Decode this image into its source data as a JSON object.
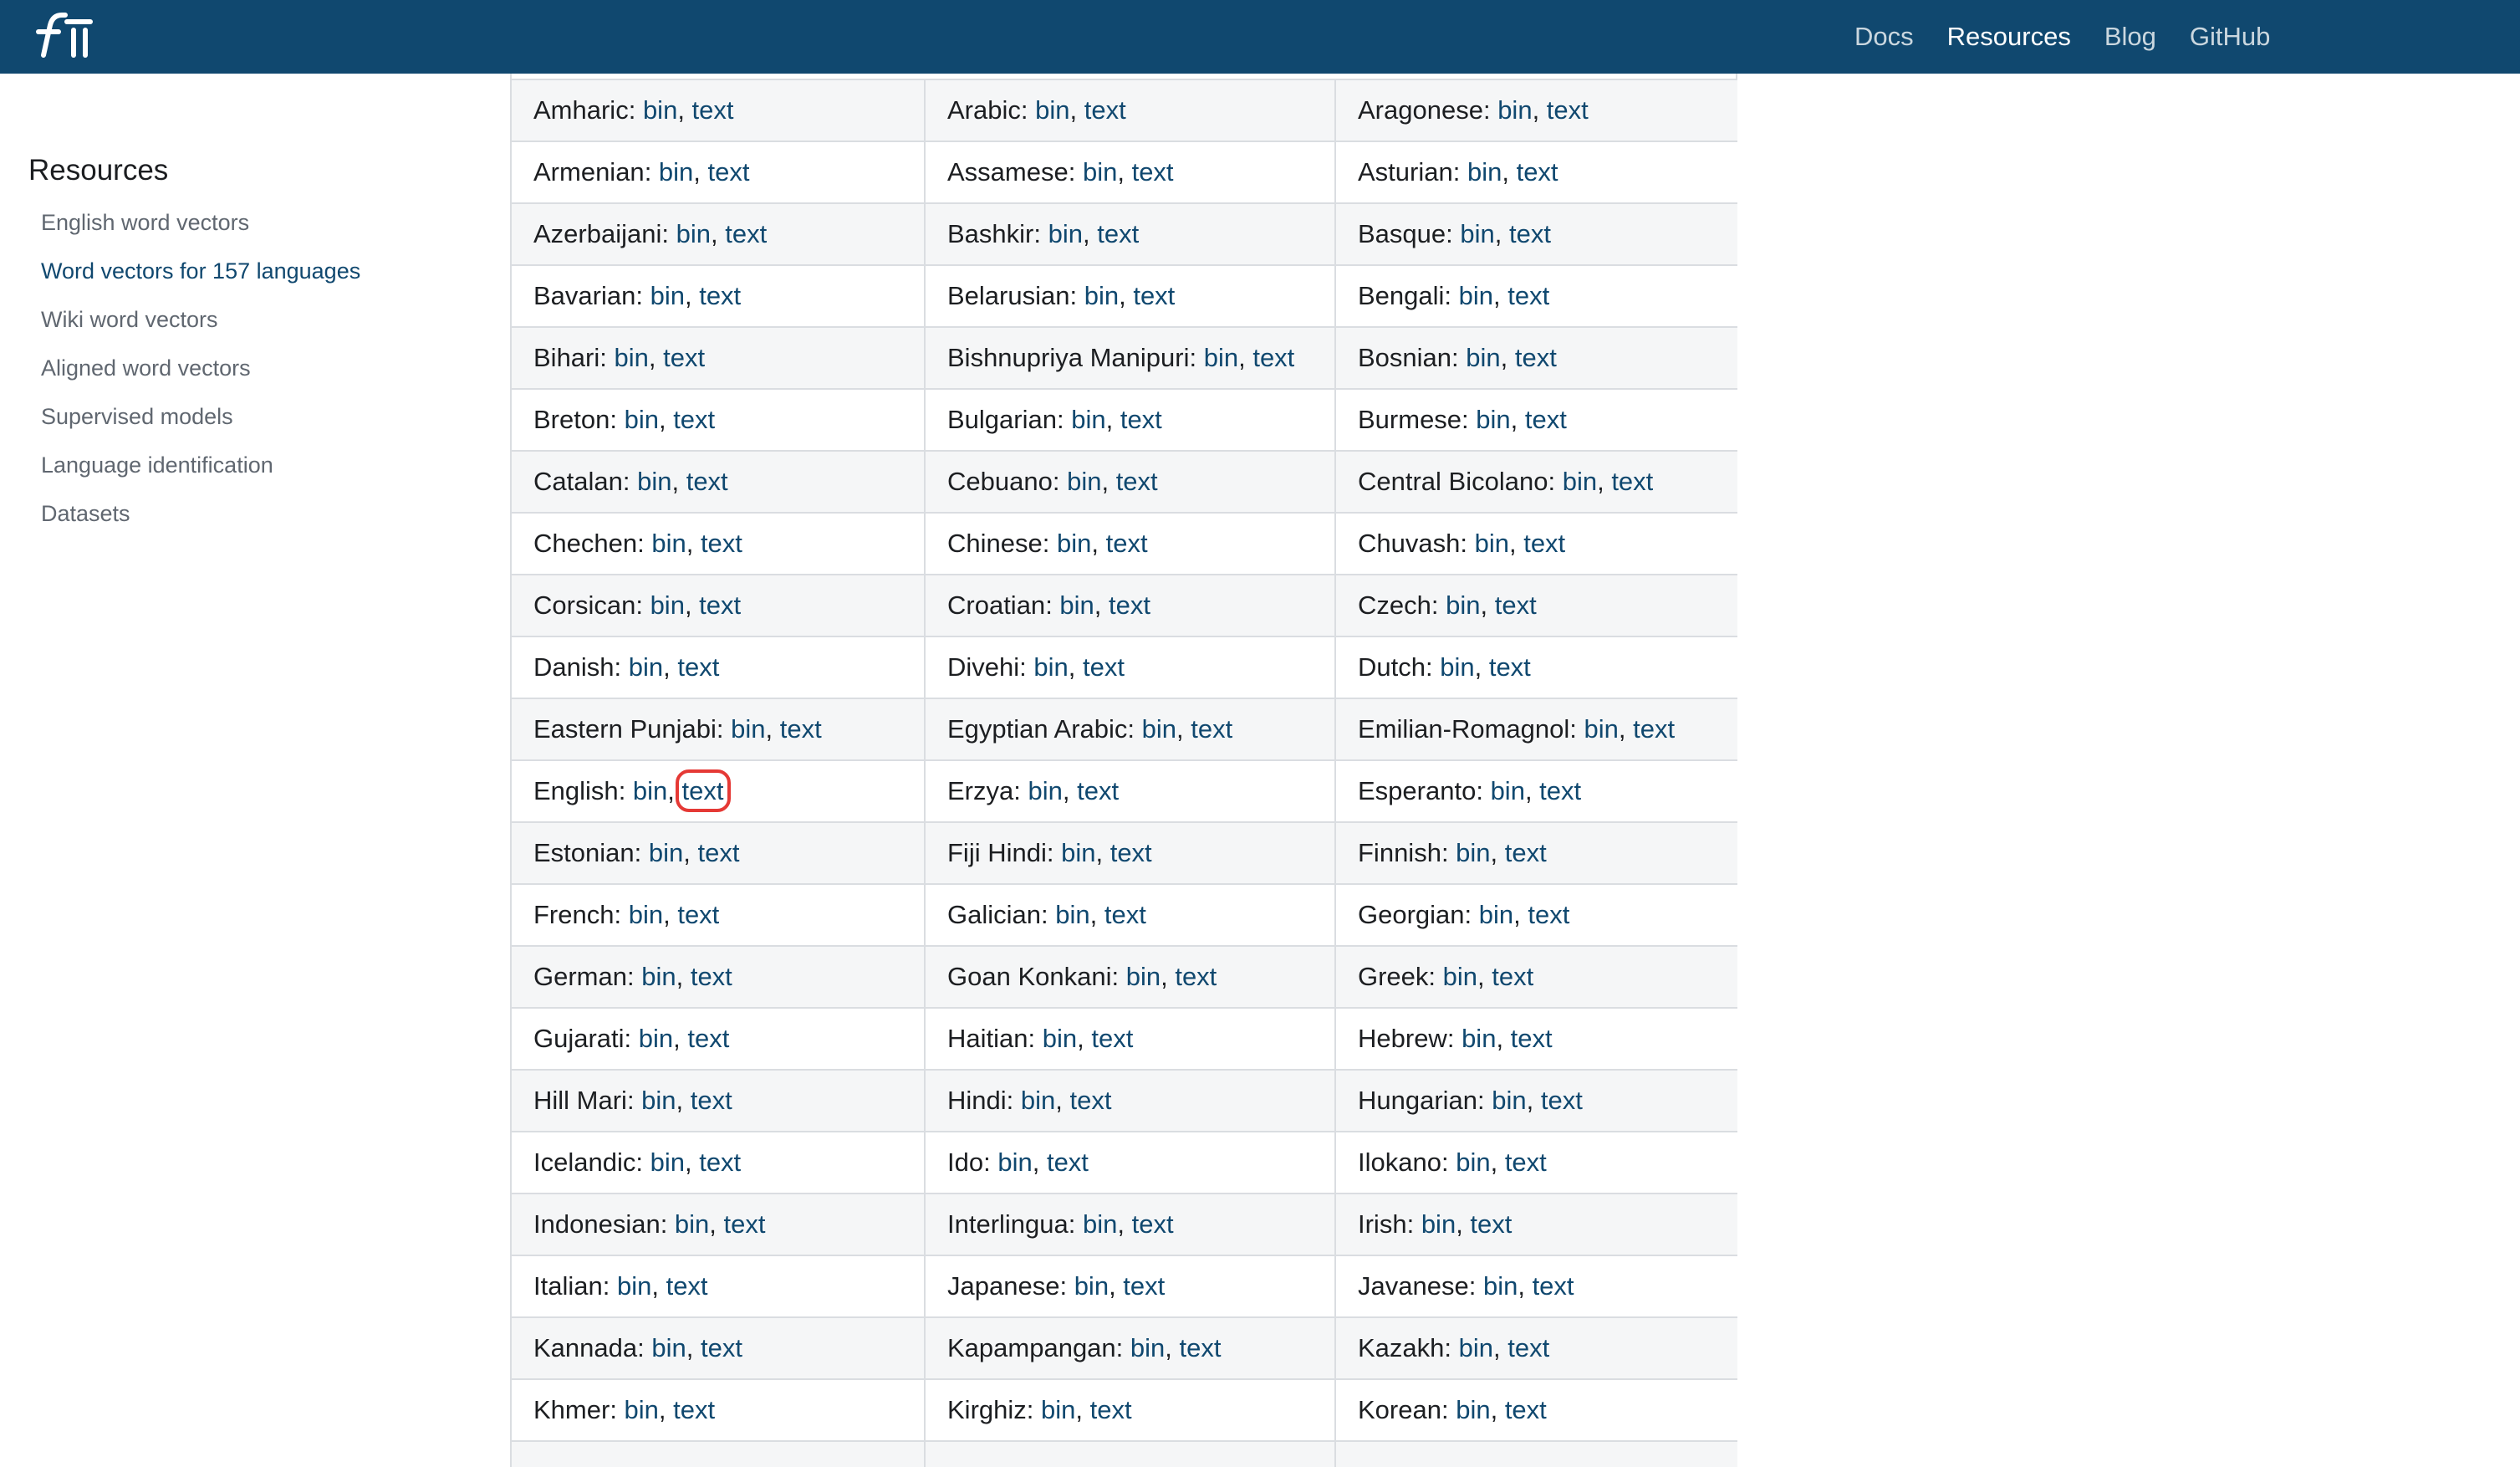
{
  "navbar": {
    "logo_alt": "fastText",
    "links": [
      {
        "label": "Docs",
        "active": false
      },
      {
        "label": "Resources",
        "active": true
      },
      {
        "label": "Blog",
        "active": false
      },
      {
        "label": "GitHub",
        "active": false
      }
    ],
    "background_color": "#10486f"
  },
  "sidebar": {
    "title": "Resources",
    "items": [
      {
        "label": "English word vectors",
        "active": false
      },
      {
        "label": "Word vectors for 157 languages",
        "active": true
      },
      {
        "label": "Wiki word vectors",
        "active": false
      },
      {
        "label": "Aligned word vectors",
        "active": false
      },
      {
        "label": "Supervised models",
        "active": false
      },
      {
        "label": "Language identification",
        "active": false
      },
      {
        "label": "Datasets",
        "active": false
      }
    ]
  },
  "table": {
    "bin_label": "bin",
    "text_label": "text",
    "separator": ", ",
    "highlighted": {
      "row": 11,
      "col": 0,
      "link": "text"
    },
    "rows": [
      [
        "Amharic",
        "Arabic",
        "Aragonese"
      ],
      [
        "Armenian",
        "Assamese",
        "Asturian"
      ],
      [
        "Azerbaijani",
        "Bashkir",
        "Basque"
      ],
      [
        "Bavarian",
        "Belarusian",
        "Bengali"
      ],
      [
        "Bihari",
        "Bishnupriya Manipuri",
        "Bosnian"
      ],
      [
        "Breton",
        "Bulgarian",
        "Burmese"
      ],
      [
        "Catalan",
        "Cebuano",
        "Central Bicolano"
      ],
      [
        "Chechen",
        "Chinese",
        "Chuvash"
      ],
      [
        "Corsican",
        "Croatian",
        "Czech"
      ],
      [
        "Danish",
        "Divehi",
        "Dutch"
      ],
      [
        "Eastern Punjabi",
        "Egyptian Arabic",
        "Emilian-Romagnol"
      ],
      [
        "English",
        "Erzya",
        "Esperanto"
      ],
      [
        "Estonian",
        "Fiji Hindi",
        "Finnish"
      ],
      [
        "French",
        "Galician",
        "Georgian"
      ],
      [
        "German",
        "Goan Konkani",
        "Greek"
      ],
      [
        "Gujarati",
        "Haitian",
        "Hebrew"
      ],
      [
        "Hill Mari",
        "Hindi",
        "Hungarian"
      ],
      [
        "Icelandic",
        "Ido",
        "Ilokano"
      ],
      [
        "Indonesian",
        "Interlingua",
        "Irish"
      ],
      [
        "Italian",
        "Japanese",
        "Javanese"
      ],
      [
        "Kannada",
        "Kapampangan",
        "Kazakh"
      ],
      [
        "Khmer",
        "Kirghiz",
        "Korean"
      ],
      [
        "",
        "",
        ""
      ]
    ]
  }
}
